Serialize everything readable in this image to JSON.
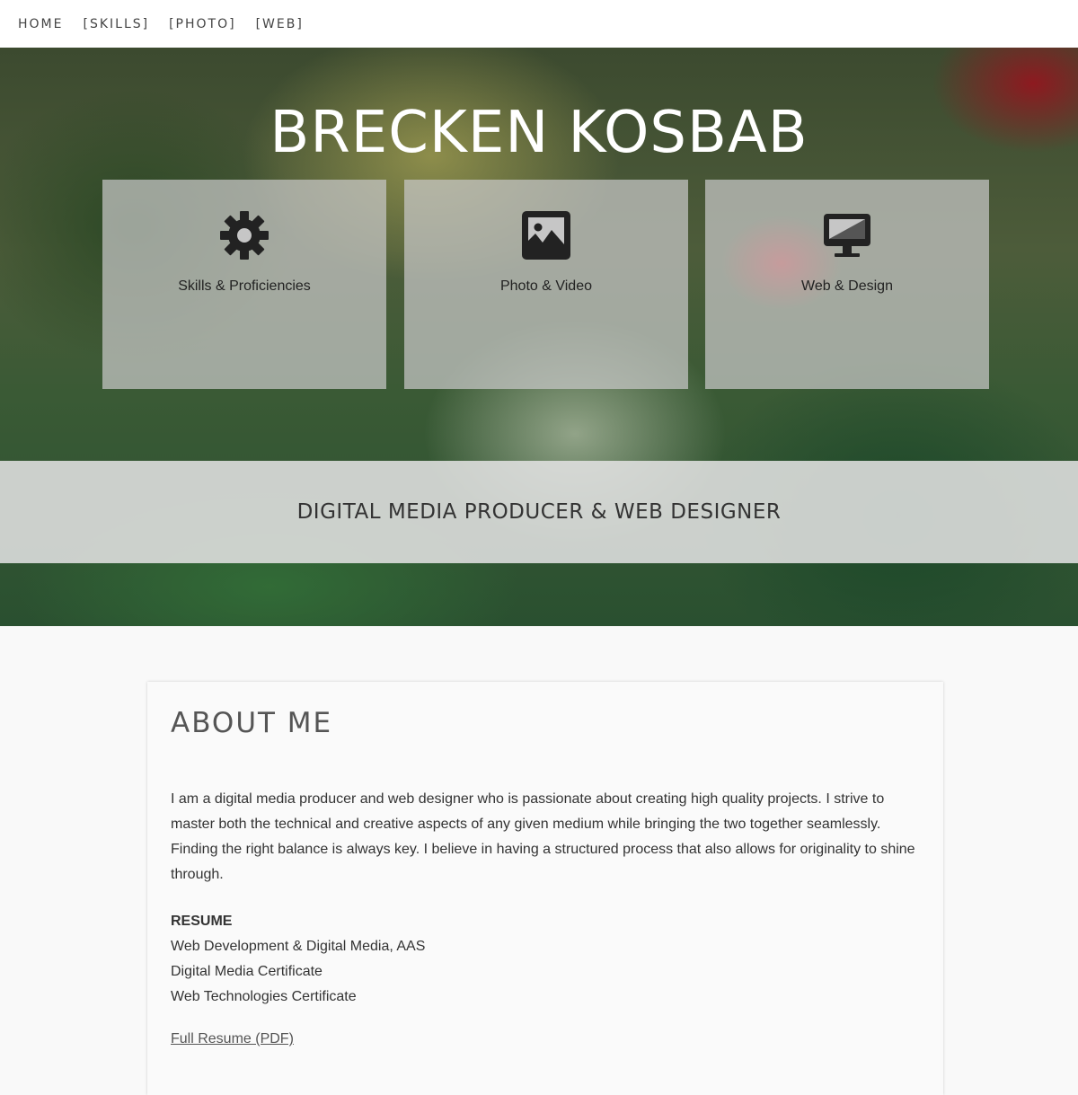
{
  "nav": {
    "items": [
      "HOME",
      "[SKILLS]",
      "[PHOTO]",
      "[WEB]"
    ]
  },
  "hero": {
    "title": "BRECKEN KOSBAB",
    "cards": [
      {
        "label": "Skills & Proficiencies",
        "icon": "gear-icon"
      },
      {
        "label": "Photo & Video",
        "icon": "picture-icon"
      },
      {
        "label": "Web & Design",
        "icon": "monitor-icon"
      }
    ],
    "tagline": "DIGITAL MEDIA PRODUCER & WEB DESIGNER"
  },
  "about": {
    "heading": "ABOUT ME",
    "intro": "I am a digital media producer and web designer who is passionate about creating high quality projects. I strive to master both the technical and creative aspects of any given medium while bringing the two together seamlessly. Finding the right balance is always key. I believe in having a structured process that also allows for originality to shine through.",
    "resume_heading": "RESUME",
    "resume_items": [
      "Web Development & Digital Media, AAS",
      "Digital Media Certificate",
      "Web Technologies Certificate"
    ],
    "resume_link": "Full Resume (PDF)"
  },
  "colors": {
    "nav_bg": "#ffffff",
    "icon": "#222222",
    "card_bg": "#c8c8c8",
    "band_bg": "#e1e1e1"
  }
}
